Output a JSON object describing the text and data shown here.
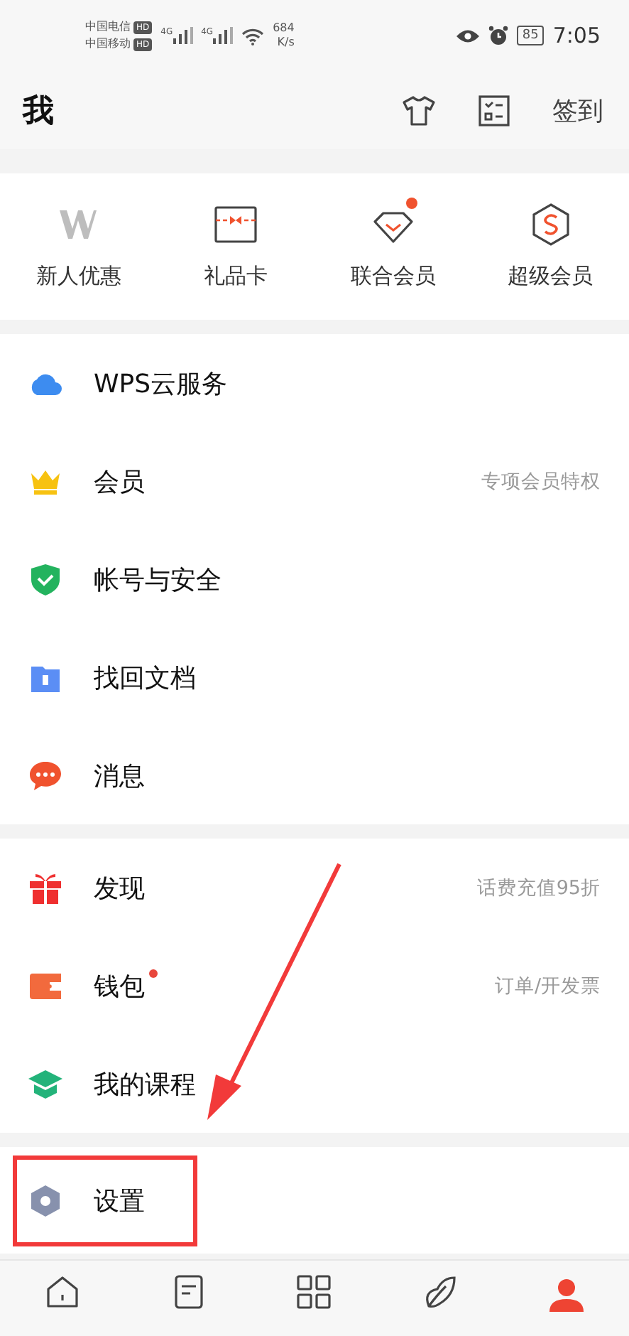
{
  "status_bar": {
    "carriers": [
      "中国电信",
      "中国移动"
    ],
    "hd_badges": [
      "HD",
      "HD"
    ],
    "network": [
      "4G",
      "4G"
    ],
    "speed_value": "684",
    "speed_unit": "K/s",
    "battery": "85",
    "time": "7:05"
  },
  "header": {
    "title": "我",
    "checkin": "签到"
  },
  "quick_actions": [
    {
      "kind": "wps",
      "label": "新人优惠",
      "dot": false
    },
    {
      "kind": "giftcard",
      "label": "礼品卡",
      "dot": false
    },
    {
      "kind": "diamond",
      "label": "联合会员",
      "dot": true
    },
    {
      "kind": "hexagon",
      "label": "超级会员",
      "dot": false
    }
  ],
  "groups": [
    {
      "items": [
        {
          "kind": "cloud",
          "label": "WPS云服务",
          "dot": false,
          "highlighted": false
        },
        {
          "kind": "crown",
          "label": "会员",
          "hint": "专项会员特权",
          "dot": false,
          "highlighted": false
        },
        {
          "kind": "shield",
          "label": "帐号与安全",
          "dot": false,
          "highlighted": false
        },
        {
          "kind": "folder",
          "label": "找回文档",
          "dot": false,
          "highlighted": false
        },
        {
          "kind": "chat",
          "label": "消息",
          "dot": false,
          "highlighted": false
        }
      ]
    },
    {
      "items": [
        {
          "kind": "gift",
          "label": "发现",
          "hint": "话费充值95折",
          "dot": false,
          "highlighted": false
        },
        {
          "kind": "wallet",
          "label": "钱包",
          "hint": "订单/开发票",
          "dot": true,
          "highlighted": false
        },
        {
          "kind": "cap",
          "label": "我的课程",
          "dot": false,
          "highlighted": false
        }
      ]
    },
    {
      "items": [
        {
          "kind": "settings",
          "label": "设置",
          "dot": false,
          "highlighted": true
        }
      ]
    }
  ],
  "bottom_nav": [
    {
      "kind": "home",
      "selected": false
    },
    {
      "kind": "doc",
      "selected": false
    },
    {
      "kind": "grid",
      "selected": false
    },
    {
      "kind": "leaf",
      "selected": false
    },
    {
      "kind": "person",
      "selected": true
    }
  ],
  "annotation": {
    "arrow": true
  }
}
